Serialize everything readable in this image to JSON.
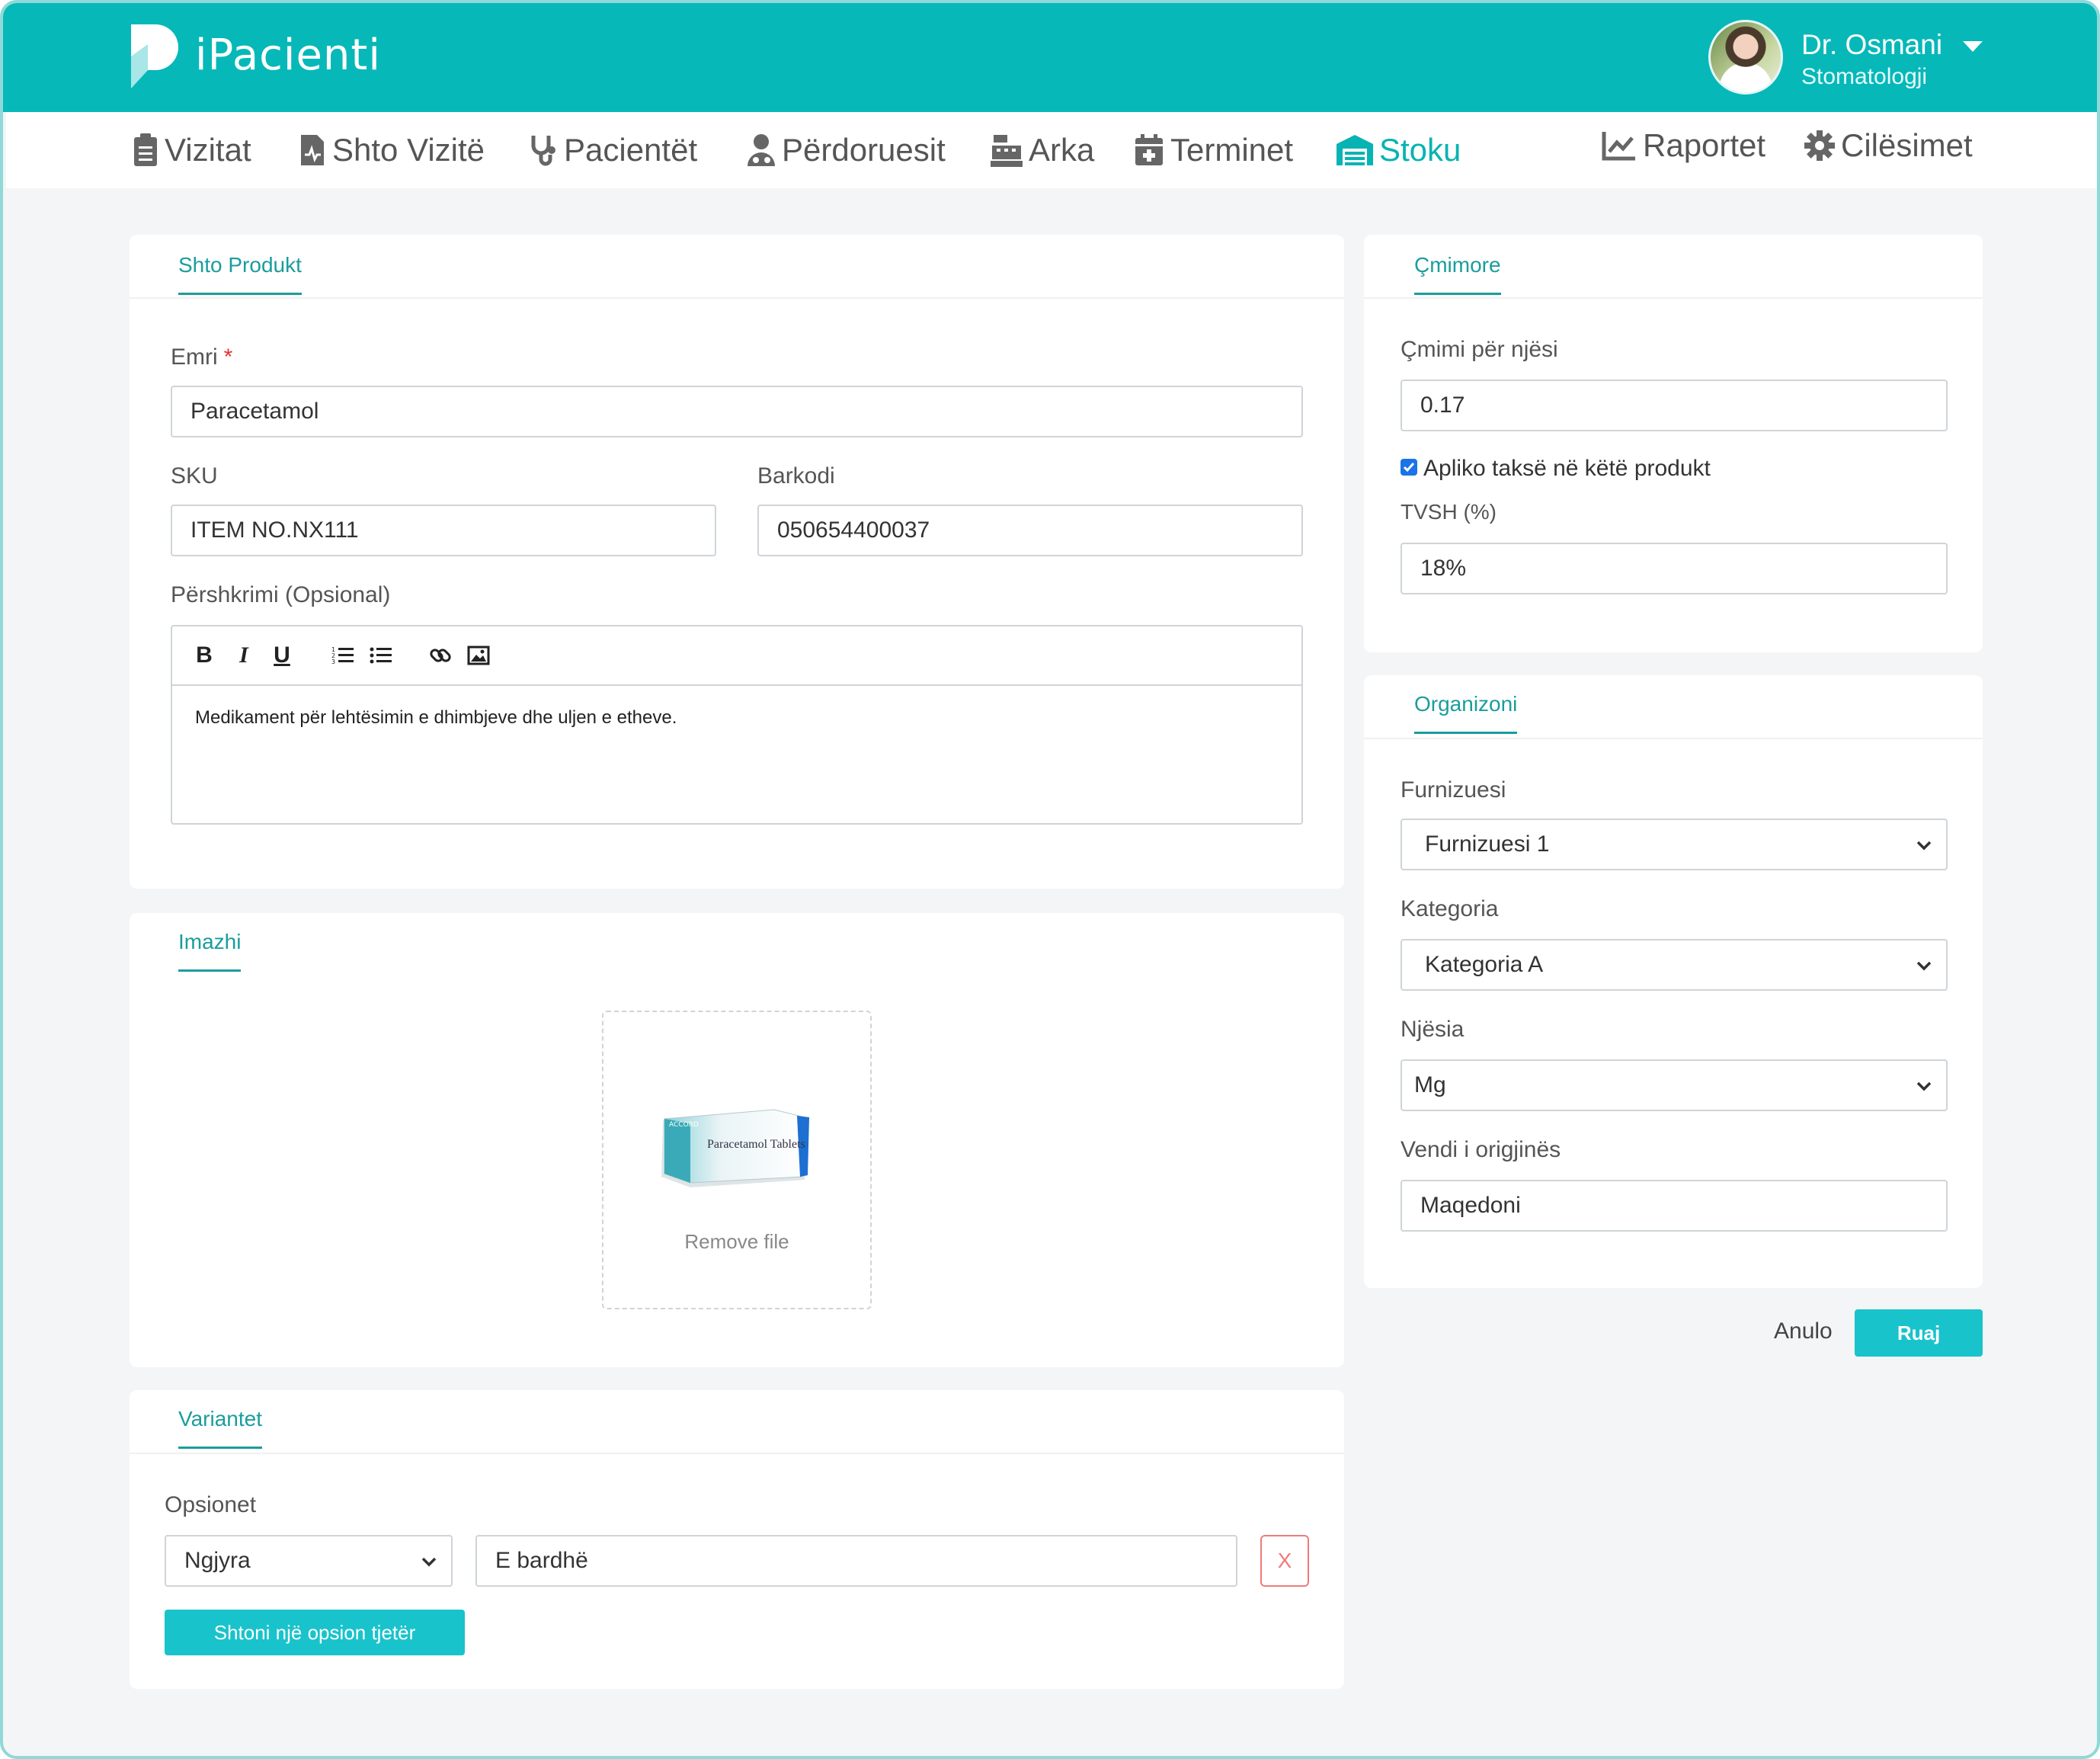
{
  "app": {
    "name": "iPacienti"
  },
  "user": {
    "name": "Dr. Osmani",
    "role": "Stomatologji"
  },
  "nav": {
    "items": [
      {
        "label": "Vizitat",
        "icon": "clipboard-icon"
      },
      {
        "label": "Shto Vizitë",
        "icon": "file-medical-icon"
      },
      {
        "label": "Pacientët",
        "icon": "stethoscope-icon"
      },
      {
        "label": "Përdoruesit",
        "icon": "user-md-icon"
      },
      {
        "label": "Arka",
        "icon": "cash-register-icon"
      },
      {
        "label": "Terminet",
        "icon": "calendar-plus-icon"
      },
      {
        "label": "Stoku",
        "icon": "warehouse-icon",
        "active": true
      },
      {
        "label": "Raportet",
        "icon": "chart-line-icon"
      },
      {
        "label": "Cilësimet",
        "icon": "gear-icon"
      }
    ]
  },
  "product": {
    "tab": "Shto Produkt",
    "name_label": "Emri",
    "name_required": "*",
    "name_value": "Paracetamol",
    "sku_label": "SKU",
    "sku_value": "ITEM NO.NX111",
    "barcode_label": "Barkodi",
    "barcode_value": "050654400037",
    "description_label": "Përshkrimi (Opsional)",
    "description_text": "Medikament për lehtësimin e dhimbjeve dhe uljen e etheve.",
    "toolbar": [
      "B",
      "I",
      "U"
    ]
  },
  "image": {
    "tab": "Imazhi",
    "remove_label": "Remove file",
    "product_box_text": "Paracetamol Tablets",
    "product_brand": "ACCORD"
  },
  "variants": {
    "tab": "Variantet",
    "options_label": "Opsionet",
    "option_select": "Ngjyra",
    "option_value": "E bardhë",
    "remove_label": "X",
    "add_button": "Shtoni një opsion tjetër"
  },
  "pricing": {
    "tab": "Çmimore",
    "unit_price_label": "Çmimi për njësi",
    "unit_price_value": "0.17",
    "apply_tax_label": "Apliko taksë në këtë produkt",
    "apply_tax_checked": true,
    "vat_label": "TVSH (%)",
    "vat_value": "18%"
  },
  "organize": {
    "tab": "Organizoni",
    "supplier_label": "Furnizuesi",
    "supplier_value": "Furnizuesi 1",
    "category_label": "Kategoria",
    "category_value": "Kategoria A",
    "unit_label": "Njësia",
    "unit_value": "Mg",
    "origin_label": "Vendi i origjinës",
    "origin_value": "Maqedoni"
  },
  "actions": {
    "cancel": "Anulo",
    "save": "Ruaj"
  },
  "colors": {
    "brand": "#07b8b9",
    "accent": "#19c3cb",
    "danger": "#ee7b7b"
  }
}
